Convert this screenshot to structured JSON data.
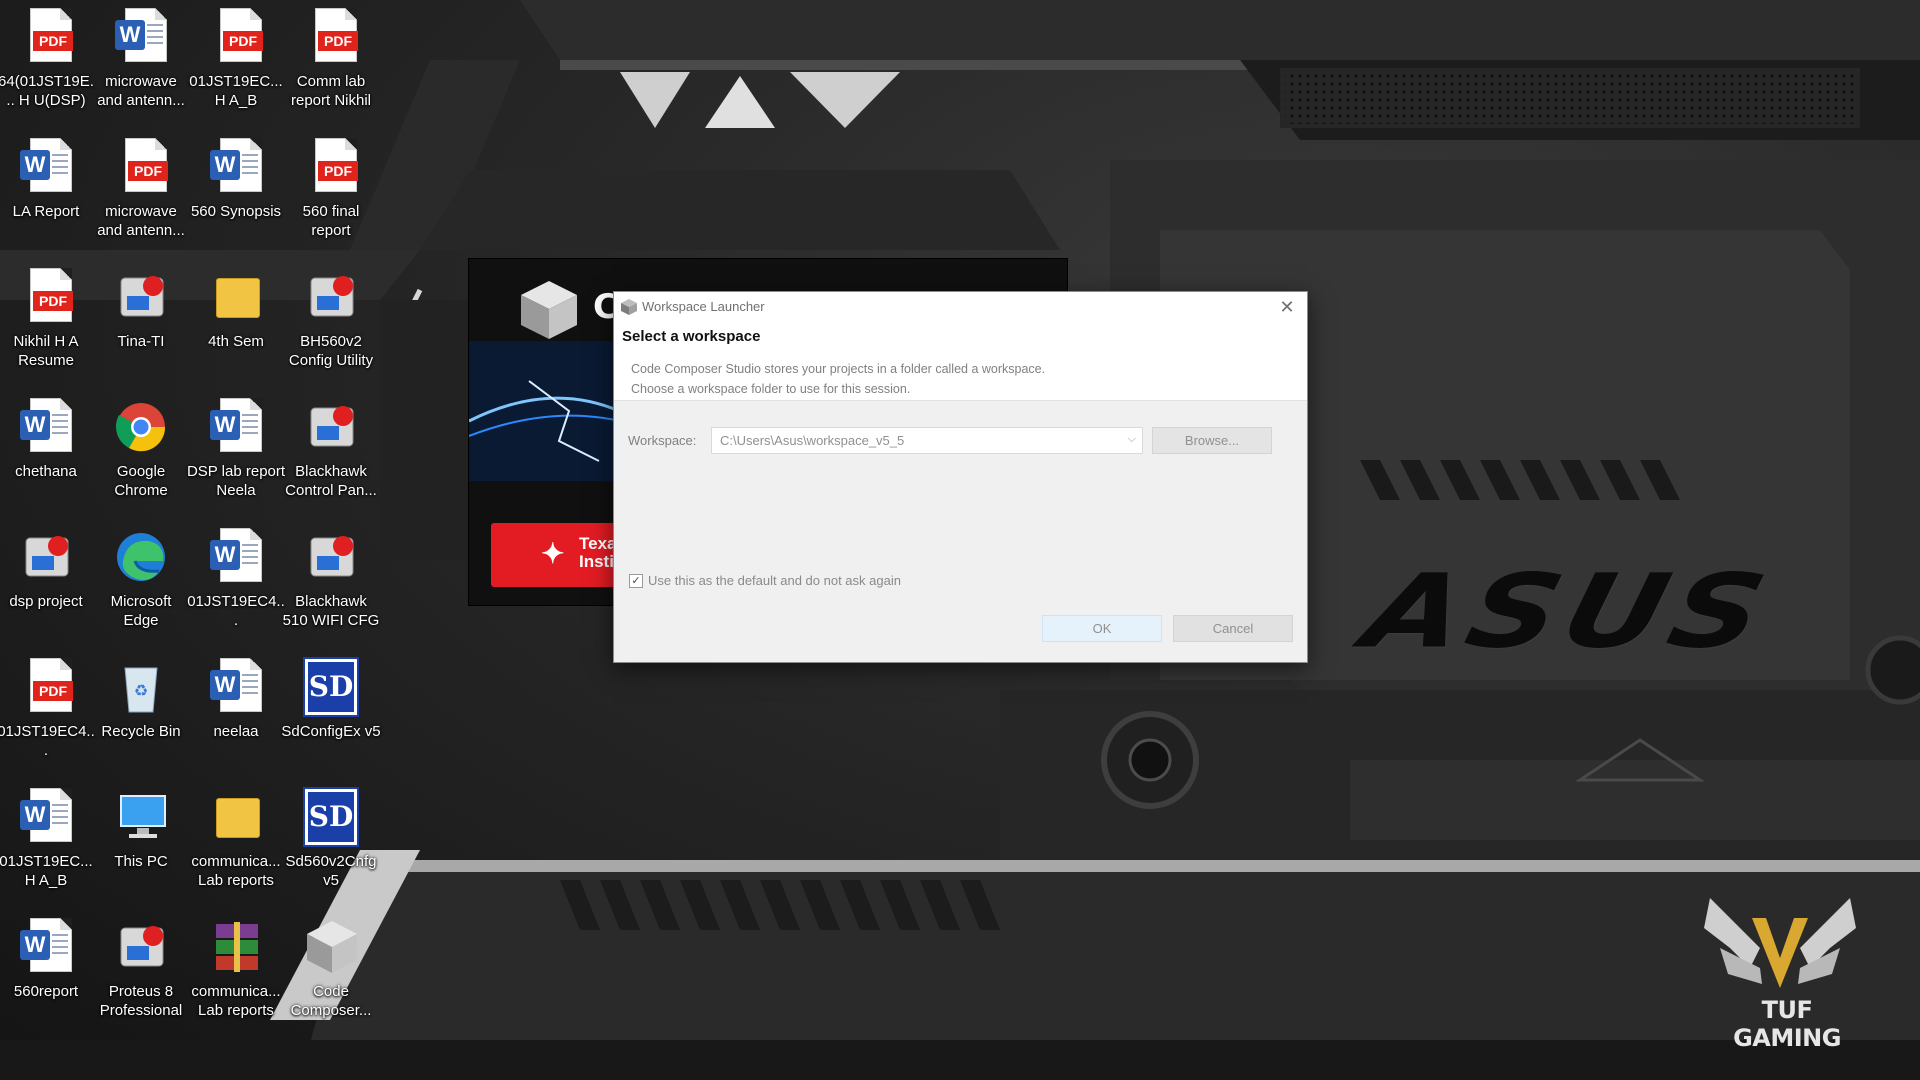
{
  "desktop": {
    "icons": [
      {
        "label": "64(01JST19E... H U(DSP)",
        "type": "pdf"
      },
      {
        "label": "microwave and antenn...",
        "type": "word"
      },
      {
        "label": "01JST19EC... H A_B",
        "type": "pdf"
      },
      {
        "label": "Comm lab report Nikhil",
        "type": "pdf"
      },
      {
        "label": "LA Report",
        "type": "word"
      },
      {
        "label": "microwave and antenn...",
        "type": "pdf"
      },
      {
        "label": "560 Synopsis",
        "type": "word"
      },
      {
        "label": "560 final report",
        "type": "pdf"
      },
      {
        "label": "Nikhil H A Resume",
        "type": "pdf"
      },
      {
        "label": "Tina-TI",
        "type": "app"
      },
      {
        "label": "4th Sem",
        "type": "folder"
      },
      {
        "label": "BH560v2 Config Utility",
        "type": "app"
      },
      {
        "label": "chethana",
        "type": "word"
      },
      {
        "label": "Google Chrome",
        "type": "chrome"
      },
      {
        "label": "DSP lab report Neela",
        "type": "word"
      },
      {
        "label": "Blackhawk Control Pan...",
        "type": "app"
      },
      {
        "label": "dsp project",
        "type": "app"
      },
      {
        "label": "Microsoft Edge",
        "type": "edge"
      },
      {
        "label": "01JST19EC4...",
        "type": "word"
      },
      {
        "label": "Blackhawk 510 WIFI CFG",
        "type": "app"
      },
      {
        "label": "01JST19EC4...",
        "type": "pdf"
      },
      {
        "label": "Recycle Bin",
        "type": "bin"
      },
      {
        "label": "neelaa",
        "type": "word"
      },
      {
        "label": "SdConfigEx v5",
        "type": "sd"
      },
      {
        "label": "01JST19EC... H A_B",
        "type": "word"
      },
      {
        "label": "This PC",
        "type": "pc"
      },
      {
        "label": "communica... Lab reports",
        "type": "folder"
      },
      {
        "label": "Sd560v2Cnfg v5",
        "type": "sd"
      },
      {
        "label": "560report",
        "type": "word"
      },
      {
        "label": "Proteus 8 Professional",
        "type": "app"
      },
      {
        "label": "communica... Lab reports",
        "type": "rar"
      },
      {
        "label": "Code Composer...",
        "type": "cube"
      }
    ]
  },
  "wallpaper": {
    "brand": "ASUS",
    "badge": "TUF GAMING"
  },
  "splash": {
    "letter": "C",
    "ti_line1": "Texas",
    "ti_line2": "Insti"
  },
  "dialog": {
    "title": "Workspace Launcher",
    "heading": "Select a workspace",
    "desc_line1": "Code Composer Studio stores your projects in a folder called a workspace.",
    "desc_line2": "Choose a workspace folder to use for this session.",
    "workspace_label": "Workspace:",
    "workspace_value": "C:\\Users\\Asus\\workspace_v5_5",
    "browse_label": "Browse...",
    "checkbox_label": "Use this as the default and do not ask again",
    "checkbox_checked": true,
    "ok_label": "OK",
    "cancel_label": "Cancel"
  },
  "colors": {
    "pdf_red": "#e0231b",
    "word_blue": "#2b5fb4",
    "ti_red": "#e31b23"
  }
}
